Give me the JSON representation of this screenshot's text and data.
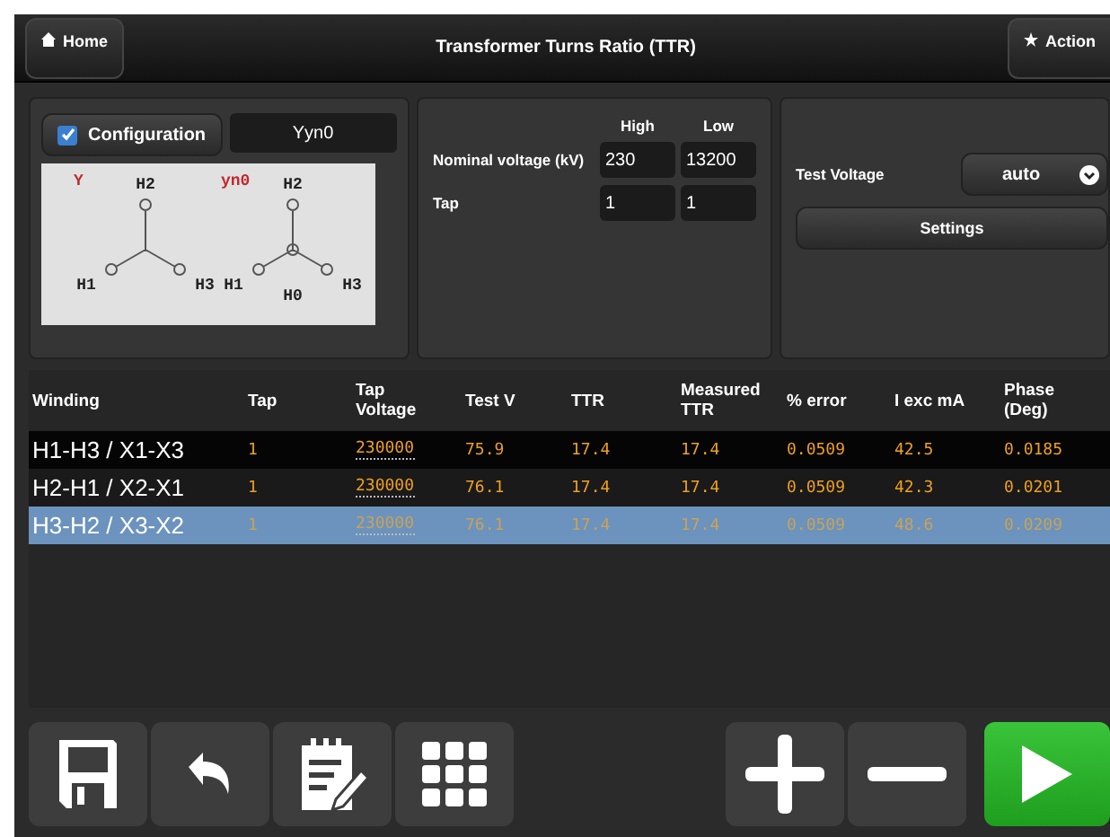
{
  "header": {
    "home": "Home",
    "title": "Transformer Turns Ratio (TTR)",
    "actions": "Action"
  },
  "configuration": {
    "label": "Configuration",
    "checked": true,
    "value": "Yyn0",
    "diagram": {
      "primary": {
        "name": "Y",
        "terminals": [
          "H2",
          "H1",
          "H3"
        ]
      },
      "secondary": {
        "name": "yn0",
        "terminals": [
          "H2",
          "H1",
          "H0",
          "H3"
        ]
      }
    }
  },
  "voltages": {
    "columns": [
      "High",
      "Low"
    ],
    "rows": [
      {
        "label": "Nominal voltage (kV)",
        "high": "230",
        "low": "13200"
      },
      {
        "label": "Tap",
        "high": "1",
        "low": "1"
      }
    ]
  },
  "test": {
    "label": "Test Voltage",
    "select": "auto",
    "settings": "Settings"
  },
  "table": {
    "columns": [
      "Winding",
      "Tap",
      "Tap Voltage",
      "Test V",
      "TTR",
      "Measured TTR",
      "% error",
      "I exc mA",
      "Phase (Deg)"
    ],
    "rows": [
      {
        "selected": false,
        "cells": [
          "H1-H3 / X1-X3",
          "1",
          "230000",
          "75.9",
          "17.4",
          "17.4",
          "0.0509",
          "42.5",
          "0.0185"
        ]
      },
      {
        "selected": false,
        "cells": [
          "H2-H1 / X2-X1",
          "1",
          "230000",
          "76.1",
          "17.4",
          "17.4",
          "0.0509",
          "42.3",
          "0.0201"
        ]
      },
      {
        "selected": true,
        "cells": [
          "H3-H2 / X3-X2",
          "1",
          "230000",
          "76.1",
          "17.4",
          "17.4",
          "0.0509",
          "48.6",
          "0.0209"
        ]
      }
    ]
  },
  "toolbar": {
    "left": [
      {
        "kind": "save"
      },
      {
        "kind": "undo"
      },
      {
        "kind": "notes"
      },
      {
        "kind": "grid"
      }
    ],
    "right": [
      {
        "kind": "plus"
      },
      {
        "kind": "minus"
      },
      {
        "kind": "play"
      }
    ]
  }
}
